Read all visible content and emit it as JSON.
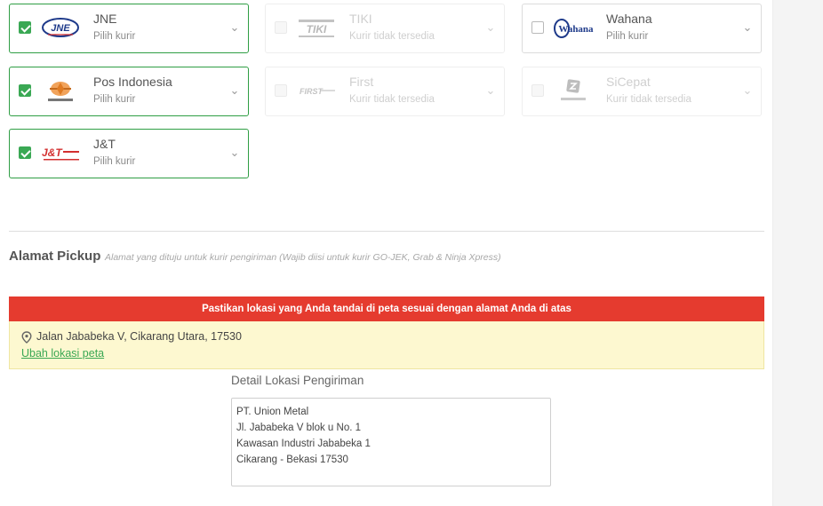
{
  "couriers": [
    {
      "id": "jne",
      "name": "JNE",
      "status": "Pilih kurir",
      "checked": true,
      "disabled": false,
      "logo": "jne-logo"
    },
    {
      "id": "tiki",
      "name": "TIKI",
      "status": "Kurir tidak tersedia",
      "checked": false,
      "disabled": true,
      "logo": "tiki-logo"
    },
    {
      "id": "wahana",
      "name": "Wahana",
      "status": "Pilih kurir",
      "checked": false,
      "disabled": false,
      "logo": "wahana-logo"
    },
    {
      "id": "pos",
      "name": "Pos Indonesia",
      "status": "Pilih kurir",
      "checked": true,
      "disabled": false,
      "logo": "pos-indonesia-logo"
    },
    {
      "id": "first",
      "name": "First",
      "status": "Kurir tidak tersedia",
      "checked": false,
      "disabled": true,
      "logo": "first-logo"
    },
    {
      "id": "sicepat",
      "name": "SiCepat",
      "status": "Kurir tidak tersedia",
      "checked": false,
      "disabled": true,
      "logo": "sicepat-logo"
    },
    {
      "id": "jnt",
      "name": "J&T",
      "status": "Pilih kurir",
      "checked": true,
      "disabled": false,
      "logo": "jnt-logo"
    }
  ],
  "pickup": {
    "title": "Alamat Pickup",
    "subtitle": "Alamat yang dituju untuk kurir pengiriman (Wajib diisi untuk kurir GO-JEK, Grab & Ninja Xpress)",
    "alert": "Pastikan lokasi yang Anda tandai di peta sesuai dengan alamat Anda di atas",
    "address": "Jalan Jababeka V, Cikarang Utara, 17530",
    "change_link": "Ubah lokasi peta",
    "detail_label": "Detail Lokasi Pengiriman",
    "detail_lines": [
      "PT. Union Metal",
      "Jl. Jababeka V blok u No. 1",
      "Kawasan Industri Jababeka 1",
      "Cikarang - Bekasi 17530"
    ]
  },
  "colors": {
    "accent": "#3aa854",
    "alert_red": "#e53b2f",
    "alert_yellow": "#fdf8d0"
  }
}
